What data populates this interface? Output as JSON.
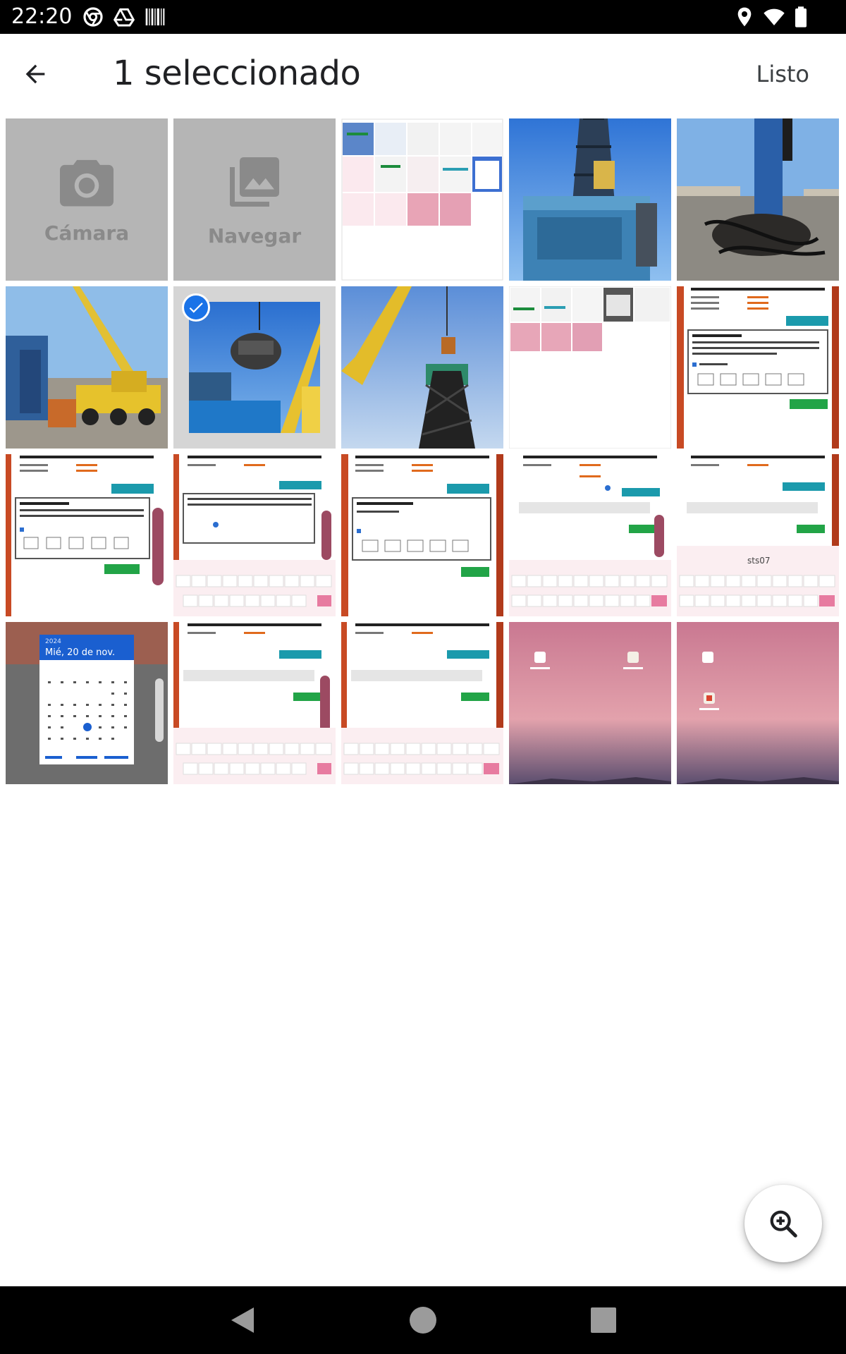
{
  "status_bar": {
    "time": "22:20",
    "left_icons": [
      "chrome-icon",
      "drive-icon",
      "barcode-icon"
    ],
    "right_icons": [
      "location-icon",
      "wifi-icon",
      "battery-icon"
    ]
  },
  "app_bar": {
    "back_icon": "arrow-back-icon",
    "title": "1 seleccionado",
    "done_label": "Listo"
  },
  "grid": {
    "camera_label": "Cámara",
    "browse_label": "Navegar",
    "items": [
      {
        "kind": "screenshot-grid",
        "selected": false
      },
      {
        "kind": "crane-blue",
        "selected": false
      },
      {
        "kind": "drill-site",
        "selected": false
      },
      {
        "kind": "crane-truck",
        "selected": false
      },
      {
        "kind": "crane-lift",
        "selected": true
      },
      {
        "kind": "crane-tower",
        "selected": false
      },
      {
        "kind": "screenshot-grid",
        "selected": false
      },
      {
        "kind": "form-screenshot",
        "selected": false
      },
      {
        "kind": "form-screenshot",
        "selected": false
      },
      {
        "kind": "form-keyboard",
        "selected": false
      },
      {
        "kind": "form-screenshot",
        "selected": false
      },
      {
        "kind": "form-keyboard",
        "selected": false
      },
      {
        "kind": "form-keyboard",
        "selected": false
      },
      {
        "kind": "date-picker",
        "selected": false
      },
      {
        "kind": "form-keyboard",
        "selected": false
      },
      {
        "kind": "form-keyboard",
        "selected": false
      },
      {
        "kind": "home-screen",
        "selected": false
      },
      {
        "kind": "home-screen",
        "selected": false
      }
    ],
    "date_picker_year": "2024",
    "date_picker_date": "Mié, 20 de nov.",
    "keyboard_word": "sts07"
  },
  "fab": {
    "icon": "zoom-in-icon"
  },
  "nav_bar": {
    "icons": [
      "back-triangle-icon",
      "home-circle-icon",
      "recents-square-icon"
    ]
  },
  "colors": {
    "accent": "#1a73e8",
    "tile_gray": "#b5b5b5",
    "tile_label": "#8a8a8a"
  }
}
